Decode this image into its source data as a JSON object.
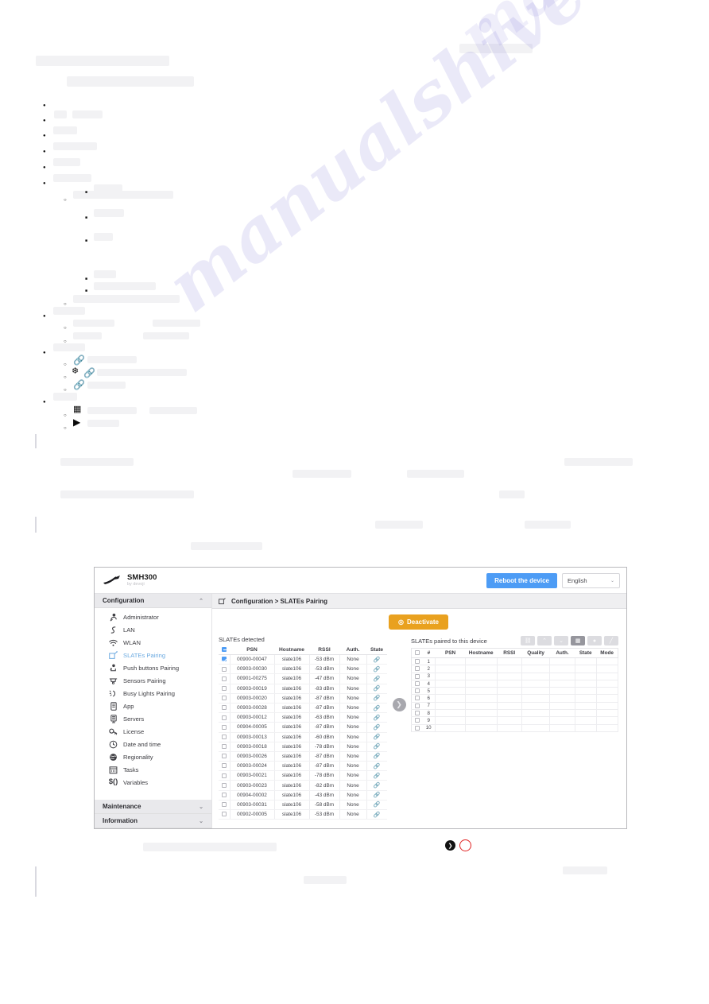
{
  "page": {
    "watermark": "manualshive.com"
  },
  "app": {
    "brand": {
      "name": "SMH300",
      "subtitle": "by devoji"
    },
    "header": {
      "reboot_label": "Reboot the device",
      "language_value": "English",
      "language_caret": "⌄"
    },
    "breadcrumb": "Configuration > SLATEs Pairing",
    "sidebar": {
      "sections": [
        {
          "label": "Configuration",
          "caret": "⌃",
          "expanded": true
        },
        {
          "label": "Maintenance",
          "caret": "⌄",
          "expanded": false
        },
        {
          "label": "Information",
          "caret": "⌄",
          "expanded": false
        }
      ],
      "items": [
        {
          "label": "Administrator",
          "icon": "administrator-icon",
          "active": false
        },
        {
          "label": "LAN",
          "icon": "lan-icon",
          "active": false
        },
        {
          "label": "WLAN",
          "icon": "wlan-icon",
          "active": false
        },
        {
          "label": "SLATEs Pairing",
          "icon": "slates-pairing-icon",
          "active": true
        },
        {
          "label": "Push buttons Pairing",
          "icon": "push-button-icon",
          "active": false
        },
        {
          "label": "Sensors Pairing",
          "icon": "sensor-icon",
          "active": false
        },
        {
          "label": "Busy Lights Pairing",
          "icon": "busy-light-icon",
          "active": false
        },
        {
          "label": "App",
          "icon": "app-icon",
          "active": false
        },
        {
          "label": "Servers",
          "icon": "server-icon",
          "active": false
        },
        {
          "label": "License",
          "icon": "key-icon",
          "active": false
        },
        {
          "label": "Date and time",
          "icon": "clock-icon",
          "active": false
        },
        {
          "label": "Regionality",
          "icon": "globe-icon",
          "active": false
        },
        {
          "label": "Tasks",
          "icon": "calendar-icon",
          "active": false
        },
        {
          "label": "Variables",
          "icon": "variables-icon",
          "active": false
        }
      ]
    },
    "main": {
      "deactivate_label": "Deactivate",
      "deactivate_icon": "broadcast-icon",
      "transfer_arrow": "❯",
      "detected": {
        "title": "SLATEs detected",
        "columns": [
          "",
          "PSN",
          "Hostname",
          "RSSI",
          "Auth.",
          "State"
        ],
        "rows": [
          {
            "checked": true,
            "psn": "00900-00047",
            "hostname": "slate106",
            "rssi": "-53 dBm",
            "auth": "None",
            "state": "link-icon"
          },
          {
            "checked": false,
            "psn": "00903-00030",
            "hostname": "slate106",
            "rssi": "-53 dBm",
            "auth": "None",
            "state": "link-icon"
          },
          {
            "checked": false,
            "psn": "00901-00275",
            "hostname": "slate106",
            "rssi": "-47 dBm",
            "auth": "None",
            "state": "link-icon"
          },
          {
            "checked": false,
            "psn": "00903-00019",
            "hostname": "slate106",
            "rssi": "-83 dBm",
            "auth": "None",
            "state": "link-icon"
          },
          {
            "checked": false,
            "psn": "00903-00020",
            "hostname": "slate106",
            "rssi": "-87 dBm",
            "auth": "None",
            "state": "link-icon"
          },
          {
            "checked": false,
            "psn": "00903-00028",
            "hostname": "slate106",
            "rssi": "-87 dBm",
            "auth": "None",
            "state": "link-icon"
          },
          {
            "checked": false,
            "psn": "00903-00012",
            "hostname": "slate106",
            "rssi": "-63 dBm",
            "auth": "None",
            "state": "link-icon"
          },
          {
            "checked": false,
            "psn": "00904-00005",
            "hostname": "slate106",
            "rssi": "-87 dBm",
            "auth": "None",
            "state": "link-icon"
          },
          {
            "checked": false,
            "psn": "00903-00013",
            "hostname": "slate106",
            "rssi": "-60 dBm",
            "auth": "None",
            "state": "link-icon"
          },
          {
            "checked": false,
            "psn": "00903-00018",
            "hostname": "slate106",
            "rssi": "-78 dBm",
            "auth": "None",
            "state": "link-icon"
          },
          {
            "checked": false,
            "psn": "00903-00026",
            "hostname": "slate106",
            "rssi": "-87 dBm",
            "auth": "None",
            "state": "link-icon"
          },
          {
            "checked": false,
            "psn": "00903-00024",
            "hostname": "slate106",
            "rssi": "-87 dBm",
            "auth": "None",
            "state": "link-icon"
          },
          {
            "checked": false,
            "psn": "00903-00021",
            "hostname": "slate106",
            "rssi": "-78 dBm",
            "auth": "None",
            "state": "link-icon"
          },
          {
            "checked": false,
            "psn": "00903-00023",
            "hostname": "slate106",
            "rssi": "-82 dBm",
            "auth": "None",
            "state": "link-icon"
          },
          {
            "checked": false,
            "psn": "00904-00002",
            "hostname": "slate106",
            "rssi": "-43 dBm",
            "auth": "None",
            "state": "link-icon"
          },
          {
            "checked": false,
            "psn": "00903-00031",
            "hostname": "slate106",
            "rssi": "-58 dBm",
            "auth": "None",
            "state": "link-icon"
          },
          {
            "checked": false,
            "psn": "00902-00005",
            "hostname": "slate106",
            "rssi": "-53 dBm",
            "auth": "None",
            "state": "link-icon"
          }
        ]
      },
      "paired": {
        "title": "SLATEs paired to this device",
        "columns": [
          "",
          "#",
          "PSN",
          "Hostname",
          "RSSI",
          "Quality",
          "Auth.",
          "State",
          "Mode"
        ],
        "row_numbers": [
          "1",
          "2",
          "3",
          "4",
          "5",
          "6",
          "7",
          "8",
          "9",
          "10"
        ],
        "toolbar": [
          {
            "name": "unpair-button",
            "glyph": "⛓",
            "active": false
          },
          {
            "name": "move-up-button",
            "glyph": "⌃",
            "active": false
          },
          {
            "name": "move-down-button",
            "glyph": "⌄",
            "active": false
          },
          {
            "name": "grid-button",
            "glyph": "▦",
            "active": true
          },
          {
            "name": "settings-button",
            "glyph": "●",
            "active": false
          },
          {
            "name": "edit-button",
            "glyph": "╱",
            "active": false
          }
        ]
      }
    }
  },
  "pager": {
    "prev_glyph": "❯",
    "items": [
      "prev-page-dot",
      "current-page-ring"
    ]
  },
  "colors": {
    "accent_blue": "#4d9cf5",
    "accent_orange": "#e9a11f",
    "active_link": "#6aa9e0",
    "ring_red": "#e02020"
  }
}
